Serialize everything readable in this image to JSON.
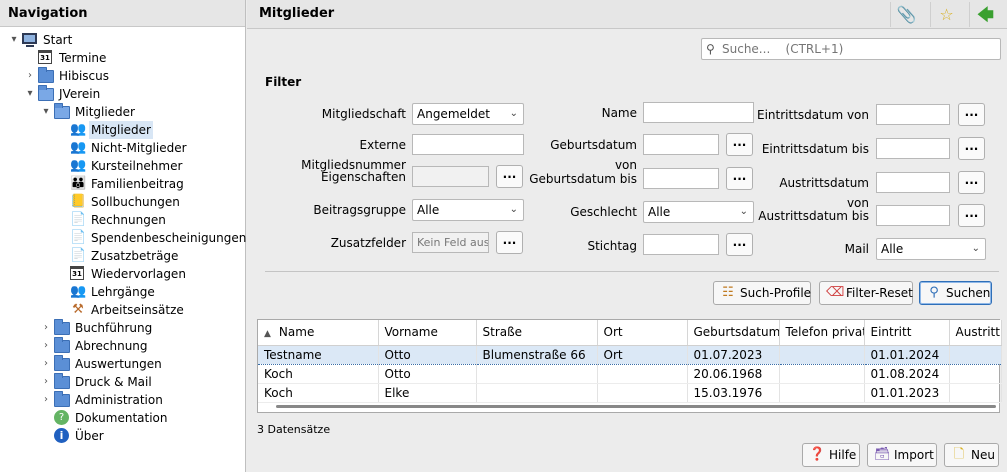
{
  "nav": {
    "title": "Navigation",
    "items": [
      {
        "label": "Start",
        "icon": "computer-icon",
        "toggle": "▾"
      },
      {
        "label": "Termine",
        "icon": "calendar-icon",
        "toggle": ""
      },
      {
        "label": "Hibiscus",
        "icon": "folder-icon",
        "toggle": "›"
      },
      {
        "label": "JVerein",
        "icon": "folder-open-icon",
        "toggle": "▾"
      },
      {
        "label": "Mitglieder",
        "icon": "folder-open-icon",
        "toggle": "▾"
      },
      {
        "label": "Mitglieder",
        "icon": "members-icon",
        "toggle": ""
      },
      {
        "label": "Nicht-Mitglieder",
        "icon": "members-icon",
        "toggle": ""
      },
      {
        "label": "Kursteilnehmer",
        "icon": "members-icon",
        "toggle": ""
      },
      {
        "label": "Familienbeitrag",
        "icon": "family-icon",
        "toggle": ""
      },
      {
        "label": "Sollbuchungen",
        "icon": "booking-icon",
        "toggle": ""
      },
      {
        "label": "Rechnungen",
        "icon": "invoice-icon",
        "toggle": ""
      },
      {
        "label": "Spendenbescheinigungen",
        "icon": "document-icon",
        "toggle": ""
      },
      {
        "label": "Zusatzbeträge",
        "icon": "document-icon",
        "toggle": ""
      },
      {
        "label": "Wiedervorlagen",
        "icon": "calendar-icon",
        "toggle": ""
      },
      {
        "label": "Lehrgänge",
        "icon": "course-icon",
        "toggle": ""
      },
      {
        "label": "Arbeitseinsätze",
        "icon": "work-icon",
        "toggle": ""
      },
      {
        "label": "Buchführung",
        "icon": "folder-icon",
        "toggle": "›"
      },
      {
        "label": "Abrechnung",
        "icon": "folder-icon",
        "toggle": "›"
      },
      {
        "label": "Auswertungen",
        "icon": "folder-icon",
        "toggle": "›"
      },
      {
        "label": "Druck & Mail",
        "icon": "folder-icon",
        "toggle": "›"
      },
      {
        "label": "Administration",
        "icon": "folder-icon",
        "toggle": "›"
      },
      {
        "label": "Dokumentation",
        "icon": "help-icon",
        "toggle": ""
      },
      {
        "label": "Über",
        "icon": "info-icon",
        "toggle": ""
      }
    ]
  },
  "main": {
    "title": "Mitglieder",
    "search_placeholder": "Suche...    (CTRL+1)",
    "filter_title": "Filter",
    "filters": {
      "mitgliedschaft_label": "Mitgliedschaft",
      "mitgliedschaft_value": "Angemeldet",
      "ext_nr_label": "Externe Mitgliedsnummer",
      "ext_nr_value": "",
      "eigenschaften_label": "Eigenschaften",
      "eigenschaften_value": "",
      "beitragsgruppe_label": "Beitragsgruppe",
      "beitragsgruppe_value": "Alle",
      "zusatzfelder_label": "Zusatzfelder",
      "zusatzfelder_value": "Kein Feld ausgewählt",
      "name_label": "Name",
      "name_value": "",
      "geb_von_label": "Geburtsdatum von",
      "geb_von_value": "",
      "geb_bis_label": "Geburtsdatum bis",
      "geb_bis_value": "",
      "geschlecht_label": "Geschlecht",
      "geschlecht_value": "Alle",
      "stichtag_label": "Stichtag",
      "stichtag_value": "",
      "eintritt_von_label": "Eintrittsdatum von",
      "eintritt_von_value": "",
      "eintritt_bis_label": "Eintrittsdatum bis",
      "eintritt_bis_value": "",
      "austritt_von_label": "Austrittsdatum von",
      "austritt_von_value": "",
      "austritt_bis_label": "Austrittsdatum bis",
      "austritt_bis_value": "",
      "mail_label": "Mail",
      "mail_value": "Alle",
      "dots": "..."
    },
    "buttons": {
      "such_profile": "Such-Profile",
      "filter_reset": "Filter-Reset",
      "suchen": "Suchen",
      "hilfe": "Hilfe",
      "import": "Import",
      "neu": "Neu"
    },
    "table": {
      "sort_indicator": "▲",
      "columns": [
        "Name",
        "Vorname",
        "Straße",
        "Ort",
        "Geburtsdatum",
        "Telefon privat",
        "Eintritt",
        "Austritt"
      ],
      "rows": [
        [
          "Testname",
          "Otto",
          "Blumenstraße 66",
          "Ort",
          "01.07.2023",
          "",
          "01.01.2024",
          ""
        ],
        [
          "Koch",
          "Otto",
          "",
          "",
          "20.06.1968",
          "",
          "01.08.2024",
          ""
        ],
        [
          "Koch",
          "Elke",
          "",
          "",
          "15.03.1976",
          "",
          "01.01.2023",
          ""
        ]
      ]
    },
    "record_count": "3 Datensätze"
  }
}
